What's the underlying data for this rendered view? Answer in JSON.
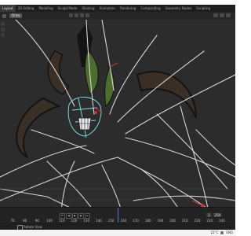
{
  "workspace_tabs": [
    {
      "label": "Layout",
      "active": true
    },
    {
      "label": "2D Editing"
    },
    {
      "label": "Modeling"
    },
    {
      "label": "Sculpt Mode"
    },
    {
      "label": "Shading"
    },
    {
      "label": "Animation"
    },
    {
      "label": "Rendering"
    },
    {
      "label": "Compositing"
    },
    {
      "label": "Geometry Nodes"
    },
    {
      "label": "Scripting"
    }
  ],
  "header": {
    "mode_select": "Draw"
  },
  "timeline": {
    "ticks": [
      "70",
      "80",
      "90",
      "100",
      "110",
      "120",
      "130",
      "140",
      "150",
      "160",
      "170",
      "180",
      "190",
      "200",
      "210",
      "220",
      "230",
      "240"
    ],
    "start_frame": "1",
    "end_frame": "250"
  },
  "status": {
    "text": "Rotate View"
  },
  "taskbar": {
    "temp": "22°C",
    "lang": "ENG"
  },
  "colors": {
    "stroke_main": "#d6d6d6",
    "stroke_dark": "#141414",
    "horn": "#3a2f25",
    "accent_red": "#d43030",
    "accent_cyan": "#7fe8f0",
    "leaf_green": "#4b6e2c"
  }
}
